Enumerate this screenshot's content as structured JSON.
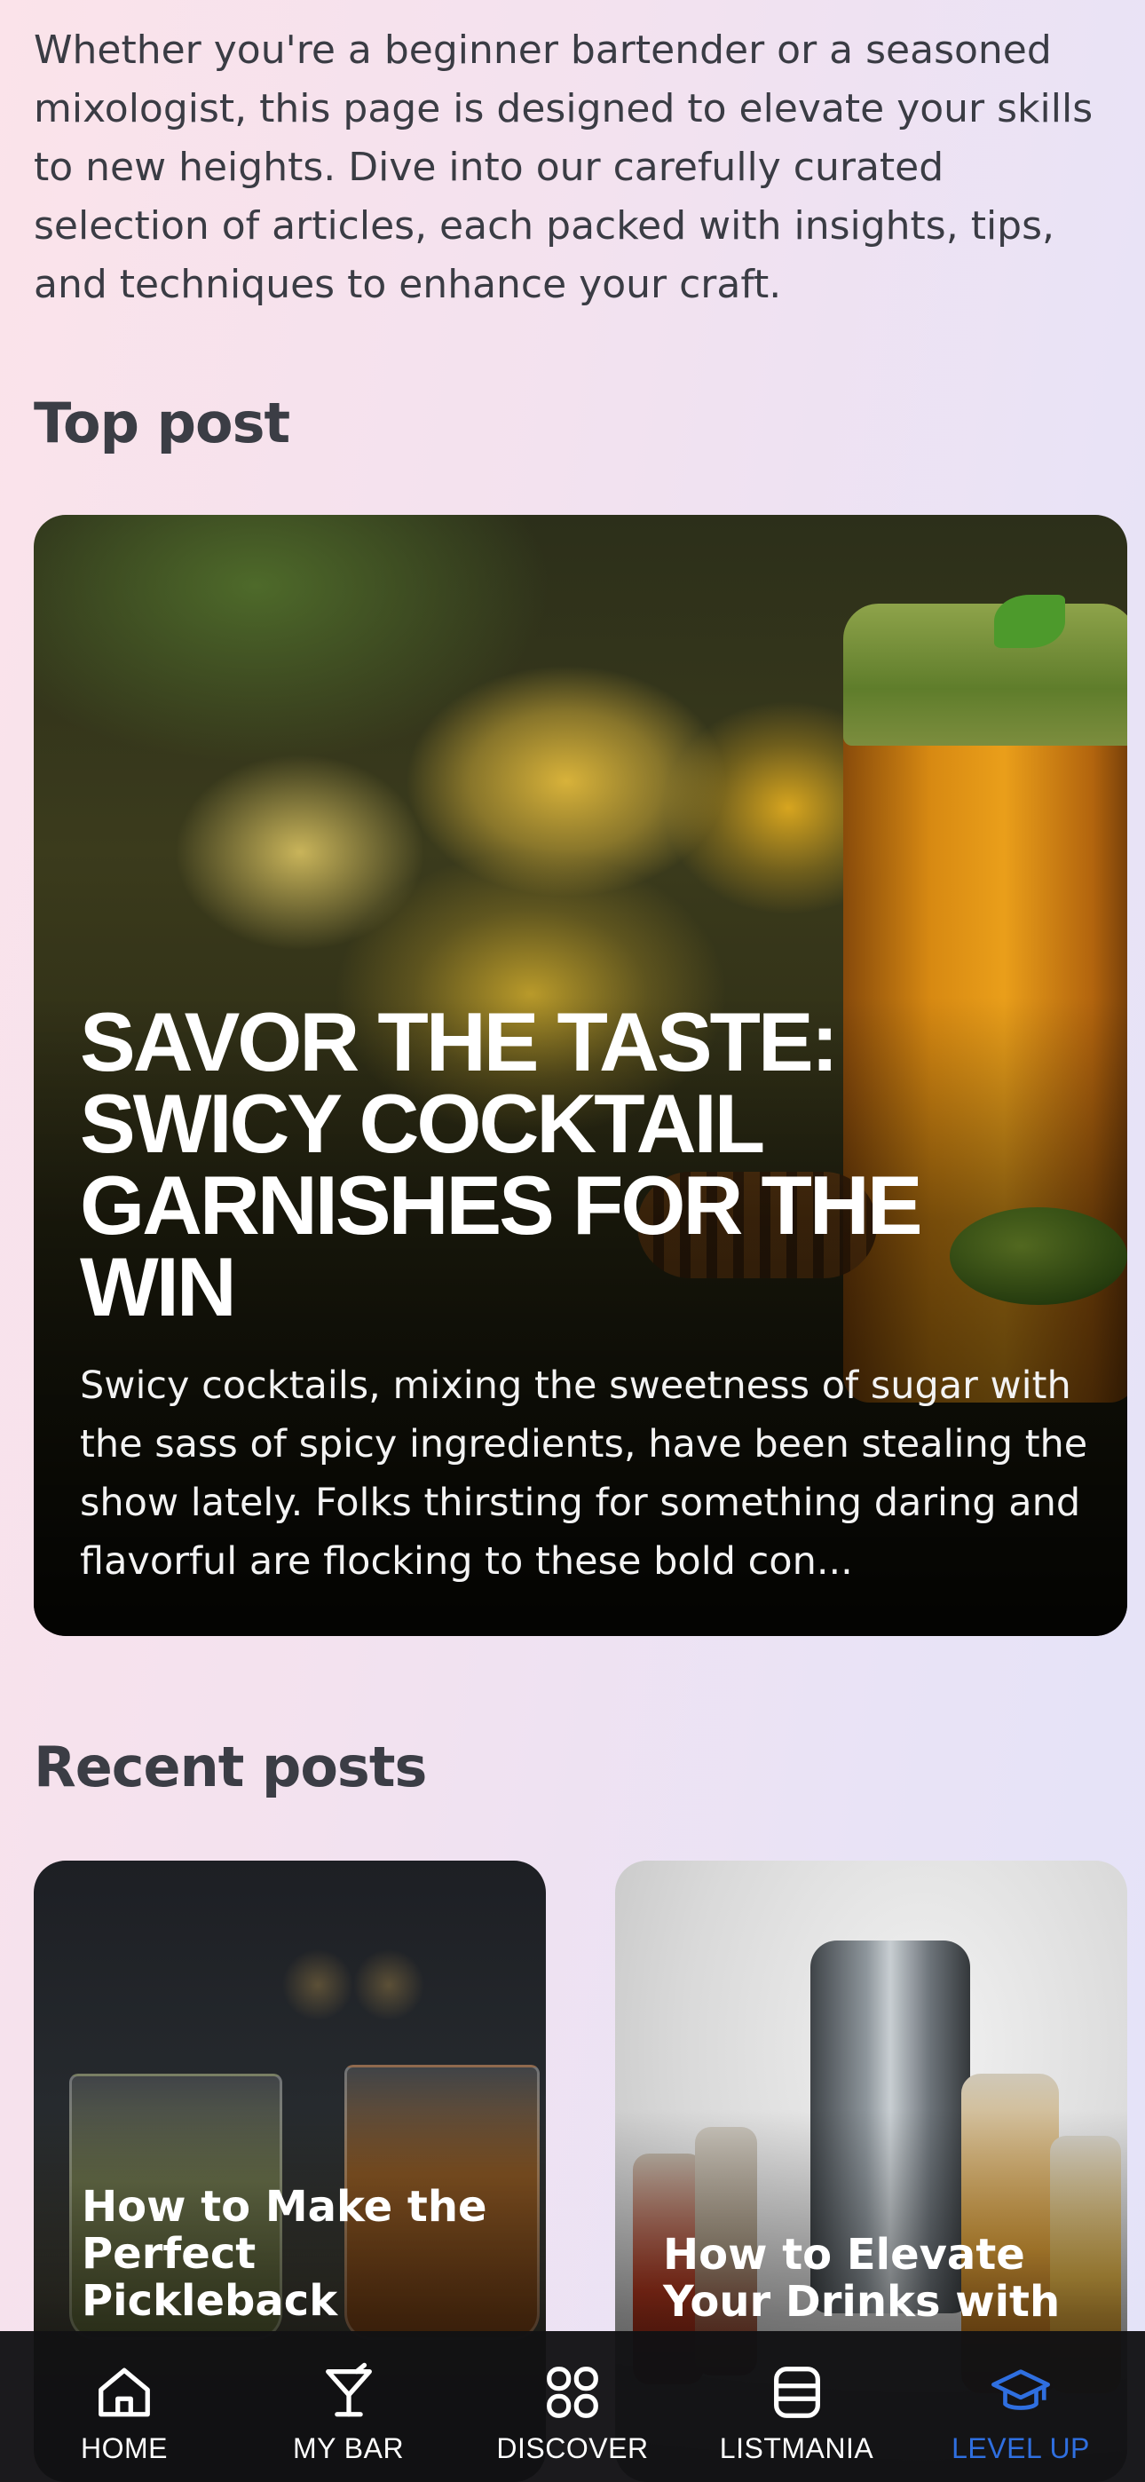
{
  "intro": "Whether you're a beginner bartender or a seasoned mixologist, this page is designed to elevate your skills to new heights. Dive into our carefully curated selection of articles, each packed with insights, tips, and techniques to enhance your craft.",
  "sections": {
    "top_post_heading": "Top post",
    "recent_posts_heading": "Recent posts"
  },
  "top_post": {
    "title": "SAVOR THE TASTE: SWICY COCKTAIL GARNISHES FOR THE WIN",
    "excerpt": "Swicy cocktails, mixing the sweetness of sugar with the sass of spicy ingredients, have been stealing the show lately. Folks thirsting for something daring and flavorful are flocking to these bold con..."
  },
  "recent_posts": [
    {
      "title": "How to Make the Perfect Pickleback"
    },
    {
      "title": "How to Elevate Your Drinks with"
    }
  ],
  "tabbar": {
    "active_color": "#2f6fe0",
    "items": [
      {
        "label": "HOME",
        "icon": "home-icon"
      },
      {
        "label": "MY BAR",
        "icon": "cocktail-glass-icon"
      },
      {
        "label": "DISCOVER",
        "icon": "grid-icon"
      },
      {
        "label": "LISTMANIA",
        "icon": "list-icon"
      },
      {
        "label": "LEVEL UP",
        "icon": "graduation-cap-icon"
      }
    ]
  }
}
